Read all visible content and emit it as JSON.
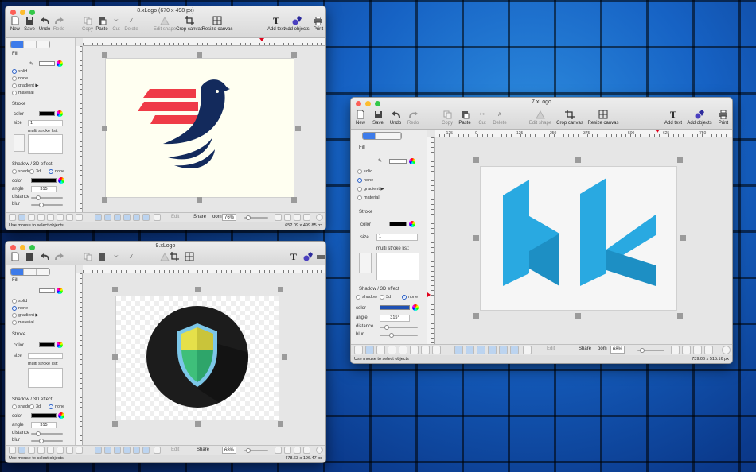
{
  "windows": [
    {
      "title": "8.xLogo (670 x 498 px)",
      "toolbar": [
        "New",
        "Save",
        "Undo",
        "Redo",
        "Copy",
        "Paste",
        "Cut",
        "Delete",
        "Edit shape",
        "Crop canvas",
        "Resize canvas",
        "Add text",
        "Add objects",
        "Print"
      ],
      "panel": {
        "fill": "Fill",
        "solid": "solid",
        "none": "none",
        "gradient": "gradient ▶",
        "material": "material",
        "stroke": "Stroke",
        "color": "color",
        "size": "size",
        "size_value": "1",
        "multi": "multi stroke list:",
        "shadow_title": "Shadow / 3D effect",
        "shadow": "shadow",
        "three_d": "3d",
        "none2": "none",
        "angle": "angle",
        "angle_value": "315",
        "distance": "distance",
        "blur": "blur"
      },
      "share": "Share",
      "zoom_label": "oom",
      "zoom": "76%",
      "edit": "Edit",
      "status_left": "Use mouse to select objects",
      "status_right": "652.09 x 499.85 px",
      "ruler": [
        "-125",
        "0",
        "125",
        "250",
        "375",
        "500",
        "625",
        "750"
      ]
    },
    {
      "title": "9.xLogo",
      "panel": {
        "fill": "Fill",
        "solid": "solid",
        "none": "none",
        "gradient": "gradient ▶",
        "material": "material",
        "stroke": "Stroke",
        "color": "color",
        "size": "size",
        "multi": "multi stroke list:",
        "shadow_title": "Shadow / 3D effect",
        "shadow": "shadow",
        "three_d": "3d",
        "none2": "none",
        "angle": "angle",
        "angle_value": "315",
        "distance": "distance",
        "blur": "blur"
      },
      "share": "Share",
      "zoom": "68%",
      "edit": "Edit",
      "status_left": "Use mouse to select objects",
      "status_right": "478.63 x 196.47 px",
      "ruler": [
        "-125",
        "0",
        "125",
        "250",
        "375",
        "500",
        "625",
        "750"
      ]
    },
    {
      "title": "7.xLogo",
      "toolbar": [
        "New",
        "Save",
        "Undo",
        "Redo",
        "Copy",
        "Paste",
        "Cut",
        "Delete",
        "Edit shape",
        "Crop canvas",
        "Resize canvas",
        "Add text",
        "Add objects",
        "Print"
      ],
      "panel": {
        "fill": "Fill",
        "solid": "solid",
        "none": "none",
        "gradient": "gradient ▶",
        "material": "material",
        "stroke": "Stroke",
        "color": "color",
        "size": "size",
        "size_value": "1",
        "multi": "multi stroke list:",
        "shadow_title": "Shadow / 3D effect",
        "shadow": "shadow",
        "three_d": "3d",
        "none2": "none",
        "angle": "angle",
        "angle_value": "315°",
        "distance": "distance",
        "blur": "blur"
      },
      "share": "Share",
      "zoom_label": "oom",
      "zoom": "68%",
      "edit": "Edit",
      "status_left": "Use mouse to select objects",
      "status_right": "739.06 x 515.16 px",
      "ruler": [
        "-125",
        "0",
        "125",
        "250",
        "375",
        "500",
        "625",
        "750"
      ],
      "vruler": [
        "0",
        "125",
        "250",
        "375",
        "500"
      ]
    }
  ],
  "colors": {
    "accent": "#3d7bea",
    "bird_red": "#ef3b47",
    "bird_navy": "#132a5c",
    "bk_blue": "#29a9e1",
    "shield_dark": "#1c1c1c"
  }
}
